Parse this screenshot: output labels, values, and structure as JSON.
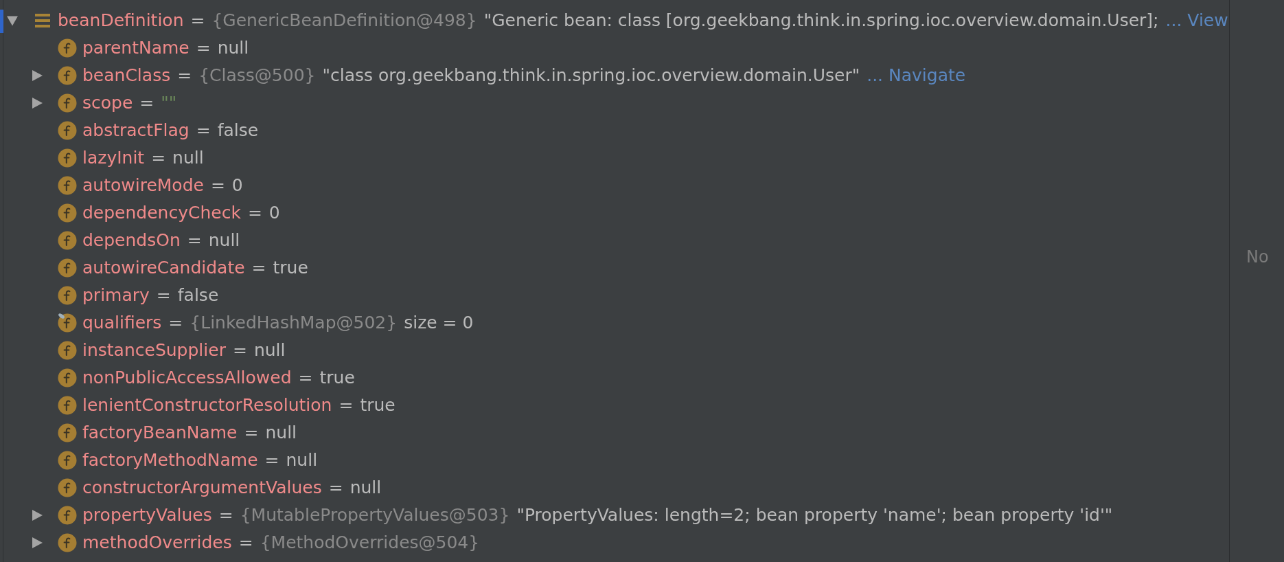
{
  "variables": {
    "items": [
      {
        "name": "beanDefinition",
        "kind": "local",
        "expanded": true,
        "marked": false,
        "sign": "=",
        "type": "{GenericBeanDefinition@498}",
        "value": {
          "text": "\"Generic bean: class [org.geekbang.think.in.spring.ioc.overview.domain.User];",
          "kind": "plain"
        },
        "link": "... View",
        "children": [
          {
            "name": "parentName",
            "kind": "field",
            "marked": false,
            "sign": "=",
            "value": {
              "text": "null",
              "kind": "plain"
            }
          },
          {
            "name": "beanClass",
            "kind": "field",
            "expanded": false,
            "marked": false,
            "sign": "=",
            "type": "{Class@500}",
            "value": {
              "text": "\"class org.geekbang.think.in.spring.ioc.overview.domain.User\"",
              "kind": "plain"
            },
            "link": "... Navigate"
          },
          {
            "name": "scope",
            "kind": "field",
            "expanded": false,
            "marked": false,
            "sign": "=",
            "value": {
              "text": "\"\"",
              "kind": "string"
            }
          },
          {
            "name": "abstractFlag",
            "kind": "field",
            "marked": false,
            "sign": "=",
            "value": {
              "text": "false",
              "kind": "plain"
            }
          },
          {
            "name": "lazyInit",
            "kind": "field",
            "marked": false,
            "sign": "=",
            "value": {
              "text": "null",
              "kind": "plain"
            }
          },
          {
            "name": "autowireMode",
            "kind": "field",
            "marked": false,
            "sign": "=",
            "value": {
              "text": "0",
              "kind": "plain"
            }
          },
          {
            "name": "dependencyCheck",
            "kind": "field",
            "marked": false,
            "sign": "=",
            "value": {
              "text": "0",
              "kind": "plain"
            }
          },
          {
            "name": "dependsOn",
            "kind": "field",
            "marked": false,
            "sign": "=",
            "value": {
              "text": "null",
              "kind": "plain"
            }
          },
          {
            "name": "autowireCandidate",
            "kind": "field",
            "marked": false,
            "sign": "=",
            "value": {
              "text": "true",
              "kind": "plain"
            }
          },
          {
            "name": "primary",
            "kind": "field",
            "marked": false,
            "sign": "=",
            "value": {
              "text": "false",
              "kind": "plain"
            }
          },
          {
            "name": "qualifiers",
            "kind": "field",
            "marked": true,
            "sign": "=",
            "type": "{LinkedHashMap@502}",
            "value": {
              "text": "size = 0",
              "kind": "plain"
            }
          },
          {
            "name": "instanceSupplier",
            "kind": "field",
            "marked": false,
            "sign": "=",
            "value": {
              "text": "null",
              "kind": "plain"
            }
          },
          {
            "name": "nonPublicAccessAllowed",
            "kind": "field",
            "marked": false,
            "sign": "=",
            "value": {
              "text": "true",
              "kind": "plain"
            }
          },
          {
            "name": "lenientConstructorResolution",
            "kind": "field",
            "marked": false,
            "sign": "=",
            "value": {
              "text": "true",
              "kind": "plain"
            }
          },
          {
            "name": "factoryBeanName",
            "kind": "field",
            "marked": false,
            "sign": "=",
            "value": {
              "text": "null",
              "kind": "plain"
            }
          },
          {
            "name": "factoryMethodName",
            "kind": "field",
            "marked": false,
            "sign": "=",
            "value": {
              "text": "null",
              "kind": "plain"
            }
          },
          {
            "name": "constructorArgumentValues",
            "kind": "field",
            "marked": false,
            "sign": "=",
            "value": {
              "text": "null",
              "kind": "plain"
            }
          },
          {
            "name": "propertyValues",
            "kind": "field",
            "expanded": false,
            "marked": false,
            "sign": "=",
            "type": "{MutablePropertyValues@503}",
            "value": {
              "text": "\"PropertyValues: length=2; bean property 'name'; bean property 'id'\"",
              "kind": "plain"
            }
          },
          {
            "name": "methodOverrides",
            "kind": "field",
            "expanded": false,
            "marked": false,
            "sign": "=",
            "type": "{MethodOverrides@504}"
          }
        ]
      }
    ]
  },
  "side_panel": {
    "message": "No"
  }
}
